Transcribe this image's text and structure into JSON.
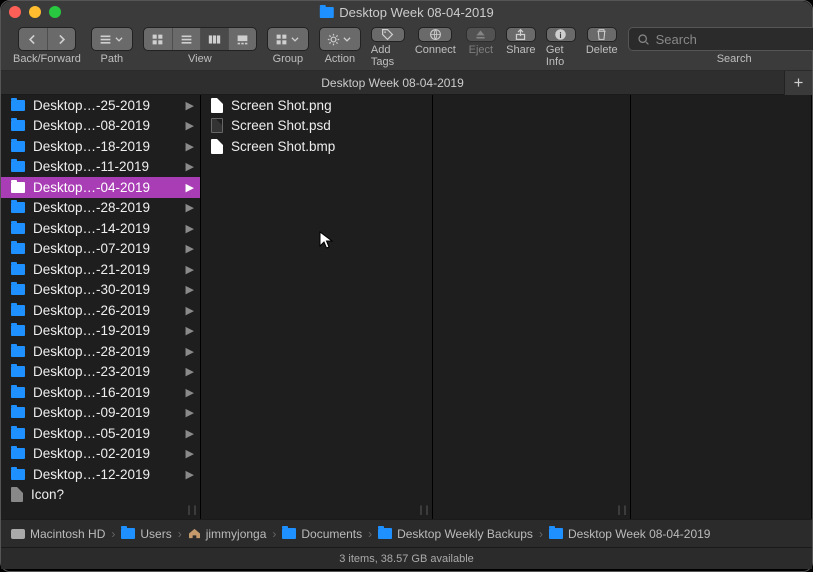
{
  "window": {
    "title": "Desktop Week 08-04-2019"
  },
  "toolbar": {
    "back_forward_label": "Back/Forward",
    "path_label": "Path",
    "view_label": "View",
    "group_label": "Group",
    "action_label": "Action",
    "add_tags_label": "Add Tags",
    "connect_label": "Connect",
    "eject_label": "Eject",
    "share_label": "Share",
    "get_info_label": "Get Info",
    "delete_label": "Delete",
    "search_placeholder": "Search",
    "search_label": "Search"
  },
  "tabs": {
    "active": "Desktop Week 08-04-2019"
  },
  "column1": {
    "items": [
      {
        "label": "Desktop…-25-2019",
        "type": "folder"
      },
      {
        "label": "Desktop…-08-2019",
        "type": "folder"
      },
      {
        "label": "Desktop…-18-2019",
        "type": "folder"
      },
      {
        "label": "Desktop…-11-2019",
        "type": "folder"
      },
      {
        "label": "Desktop…-04-2019",
        "type": "folder",
        "selected": true
      },
      {
        "label": "Desktop…-28-2019",
        "type": "folder"
      },
      {
        "label": "Desktop…-14-2019",
        "type": "folder"
      },
      {
        "label": "Desktop…-07-2019",
        "type": "folder"
      },
      {
        "label": "Desktop…-21-2019",
        "type": "folder"
      },
      {
        "label": "Desktop…-30-2019",
        "type": "folder"
      },
      {
        "label": "Desktop…-26-2019",
        "type": "folder"
      },
      {
        "label": "Desktop…-19-2019",
        "type": "folder"
      },
      {
        "label": "Desktop…-28-2019",
        "type": "folder"
      },
      {
        "label": "Desktop…-23-2019",
        "type": "folder"
      },
      {
        "label": "Desktop…-16-2019",
        "type": "folder"
      },
      {
        "label": "Desktop…-09-2019",
        "type": "folder"
      },
      {
        "label": "Desktop…-05-2019",
        "type": "folder"
      },
      {
        "label": "Desktop…-02-2019",
        "type": "folder"
      },
      {
        "label": "Desktop…-12-2019",
        "type": "folder"
      },
      {
        "label": "Icon?",
        "type": "doc"
      }
    ]
  },
  "column2": {
    "items": [
      {
        "label": "Screen Shot.png",
        "type": "file-light"
      },
      {
        "label": "Screen Shot.psd",
        "type": "file-dark"
      },
      {
        "label": "Screen Shot.bmp",
        "type": "file-light"
      }
    ]
  },
  "pathbar": {
    "segments": [
      {
        "label": "Macintosh HD",
        "icon": "hd"
      },
      {
        "label": "Users",
        "icon": "folder"
      },
      {
        "label": "jimmyjonga",
        "icon": "house"
      },
      {
        "label": "Documents",
        "icon": "folder"
      },
      {
        "label": "Desktop Weekly Backups",
        "icon": "folder"
      },
      {
        "label": "Desktop Week 08-04-2019",
        "icon": "folder"
      }
    ]
  },
  "status": {
    "text": "3 items, 38.57 GB available"
  }
}
